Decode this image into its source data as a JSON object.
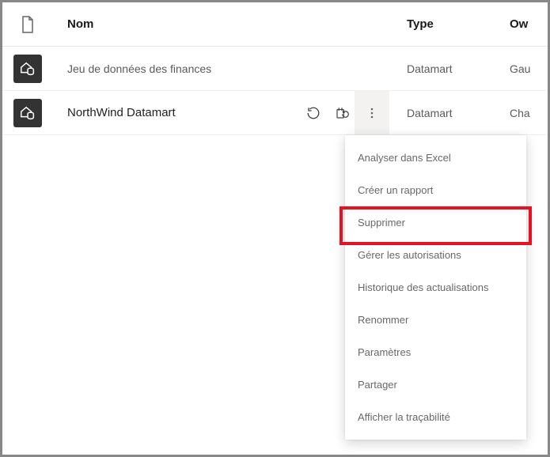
{
  "header": {
    "name": "Nom",
    "type": "Type",
    "owner": "Ow"
  },
  "rows": [
    {
      "name": "Jeu de données des finances",
      "type": "Datamart",
      "owner": "Gau"
    },
    {
      "name": "NorthWind Datamart",
      "type": "Datamart",
      "owner": "Cha"
    }
  ],
  "menu": {
    "items": [
      "Analyser dans Excel",
      "Créer un rapport",
      "Supprimer",
      "Gérer les autorisations",
      "Historique des actualisations",
      "Renommer",
      "Paramètres",
      "Partager",
      "Afficher la traçabilité"
    ]
  }
}
